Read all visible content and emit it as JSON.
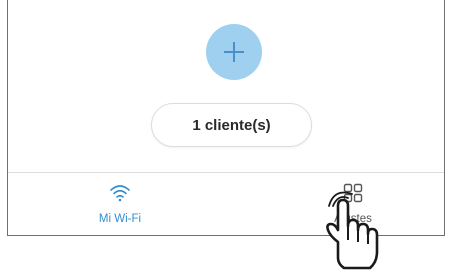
{
  "main": {
    "add_button_icon": "plus-icon",
    "clients_label": "1 cliente(s)"
  },
  "bottom_nav": {
    "items": [
      {
        "label": "Mi Wi-Fi",
        "icon": "wifi-icon",
        "active": true,
        "color": "#2f8fd1"
      },
      {
        "label": "Ajustes",
        "icon": "grid-settings-icon",
        "active": false,
        "color": "#555555"
      }
    ]
  },
  "overlay": {
    "pointer": "hand-pointer-icon"
  },
  "colors": {
    "accent": "#9fd0f0",
    "active_nav": "#2f8fd1",
    "frame_border": "#6f6f6f"
  }
}
